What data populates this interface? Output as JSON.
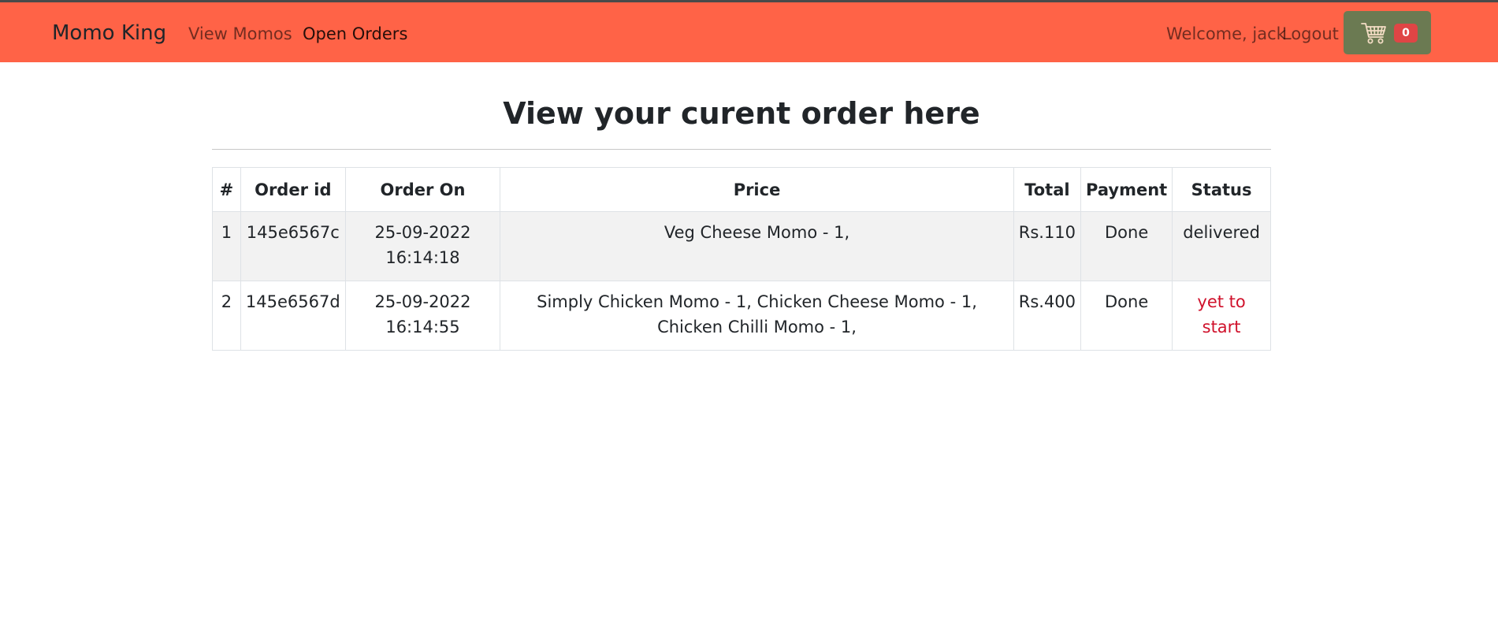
{
  "navbar": {
    "brand": "Momo King",
    "links": {
      "view_momos": "View Momos",
      "open_orders": "Open Orders"
    },
    "welcome": "Welcome, jack",
    "logout": "Logout",
    "cart_count": "0",
    "cart_icon": "shopping-cart-icon",
    "colors": {
      "background": "#ff6347",
      "cart_button": "#6b7a52",
      "badge": "#e04545"
    }
  },
  "main": {
    "title": "View your curent order here",
    "table": {
      "headers": [
        "#",
        "Order id",
        "Order On",
        "Price",
        "Total",
        "Payment",
        "Status"
      ],
      "rows": [
        {
          "num": "1",
          "order_id": "145e6567c",
          "date": "25-09-2022",
          "time": "16:14:18",
          "items": "Veg Cheese Momo - 1,",
          "total": "Rs.110",
          "payment": "Done",
          "status": "delivered"
        },
        {
          "num": "2",
          "order_id": "145e6567d",
          "date": "25-09-2022",
          "time": "16:14:55",
          "items": "Simply Chicken Momo - 1, Chicken Cheese Momo - 1, Chicken Chilli Momo - 1,",
          "total": "Rs.400",
          "payment": "Done",
          "status": "yet to start"
        }
      ]
    }
  }
}
